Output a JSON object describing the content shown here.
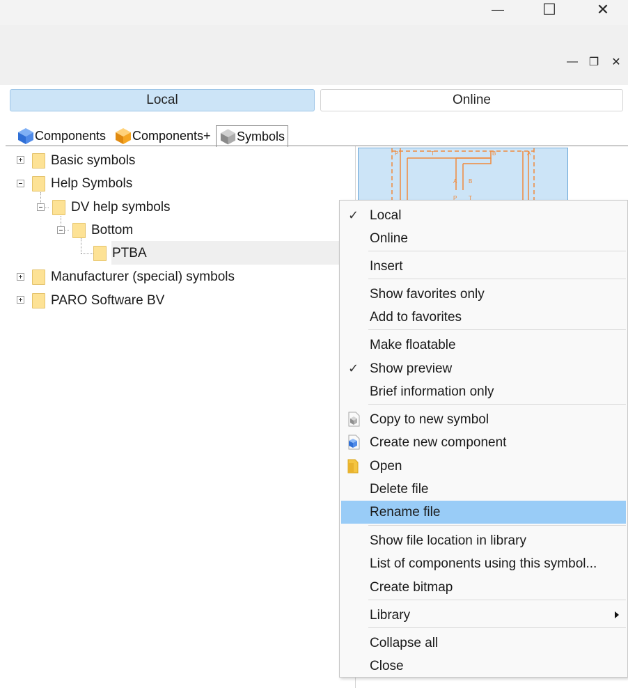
{
  "window": {
    "minimize_glyph": "—",
    "maximize_glyph": "☐",
    "close_glyph": "✕",
    "sub_minimize_glyph": "—",
    "sub_restore_glyph": "❐",
    "sub_close_glyph": "✕"
  },
  "toggle": {
    "local": "Local",
    "online": "Online"
  },
  "tabs": [
    {
      "label": "Components",
      "icon": "components-cube-icon",
      "color": "#3d7be0"
    },
    {
      "label": "Components+",
      "icon": "components-plus-cube-icon",
      "color": "#f0a020"
    },
    {
      "label": "Symbols",
      "icon": "symbols-cube-icon",
      "color": "#8c8c8c"
    }
  ],
  "tree": [
    {
      "label": "Basic symbols",
      "expander": "plus"
    },
    {
      "label": "Help Symbols",
      "expander": "minus"
    },
    {
      "label": "DV help symbols",
      "expander": "minus"
    },
    {
      "label": "Bottom",
      "expander": "minus"
    },
    {
      "label": "PTBA",
      "expander": "none",
      "selected": true
    },
    {
      "label": "Manufacturer (special) symbols",
      "expander": "plus"
    },
    {
      "label": "PARO Software BV",
      "expander": "plus"
    }
  ],
  "preview": {
    "labels": [
      "P",
      "T",
      "B",
      "A",
      "A",
      "B",
      "P",
      "T"
    ],
    "line_color": "#f08a3c"
  },
  "context_menu": {
    "items": [
      {
        "label": "Local",
        "checked": true
      },
      {
        "label": "Online"
      },
      {
        "label": "Insert"
      },
      {
        "label": "Show favorites only"
      },
      {
        "label": "Add to favorites"
      },
      {
        "label": "Make floatable"
      },
      {
        "label": "Show preview",
        "checked": true
      },
      {
        "label": "Brief information only"
      },
      {
        "label": "Copy to new symbol",
        "icon": "copy-symbol-icon"
      },
      {
        "label": "Create new component",
        "icon": "create-component-icon"
      },
      {
        "label": "Open",
        "icon": "open-folder-icon"
      },
      {
        "label": "Delete file"
      },
      {
        "label": "Rename file",
        "highlighted": true
      },
      {
        "label": "Show file location in library"
      },
      {
        "label": "List of components using this symbol..."
      },
      {
        "label": "Create bitmap"
      },
      {
        "label": "Library",
        "submenu": true
      },
      {
        "label": "Collapse all"
      },
      {
        "label": "Close"
      }
    ],
    "check_glyph": "✓",
    "highlight_color": "#99ccf7"
  }
}
